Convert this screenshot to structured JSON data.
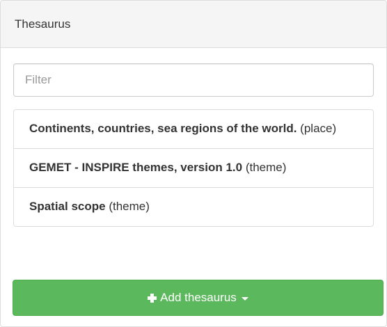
{
  "panel": {
    "title": "Thesaurus"
  },
  "filter": {
    "placeholder": "Filter",
    "value": ""
  },
  "thesaurus_list": [
    {
      "name": "Continents, countries, sea regions of the world.",
      "type": "(place)"
    },
    {
      "name": "GEMET - INSPIRE themes, version 1.0",
      "type": "(theme)"
    },
    {
      "name": "Spatial scope",
      "type": "(theme)"
    }
  ],
  "add_button": {
    "label": "Add thesaurus",
    "icon": "plus-icon",
    "dropdown_icon": "caret-down-icon"
  },
  "colors": {
    "heading_bg": "#f5f5f5",
    "border": "#dddddd",
    "button_bg": "#5cb85c",
    "button_text": "#ffffff"
  }
}
